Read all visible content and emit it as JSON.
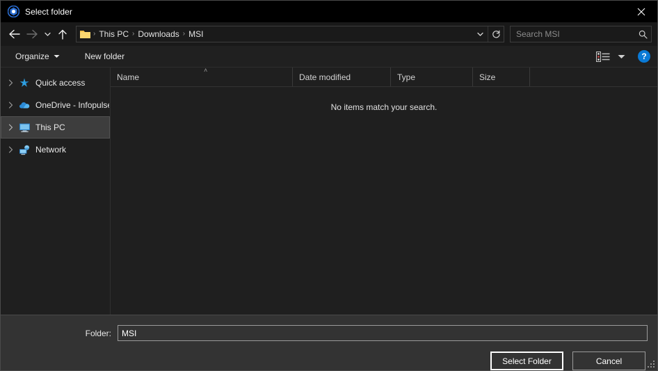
{
  "window": {
    "title": "Select folder",
    "app_icon": "app-logo-icon",
    "close_label": "✕",
    "accent_color": "#0a7ad6",
    "titlebar_bg": "#000000",
    "body_bg": "#1f1f1f",
    "footer_bg": "#333333"
  },
  "nav": {
    "back_label": "Back",
    "forward_label": "Forward",
    "recent_label": "Recent locations",
    "up_label": "Up one level"
  },
  "address": {
    "folder_icon": "folder-icon",
    "separator": "›",
    "crumbs": [
      {
        "label": "This PC"
      },
      {
        "label": "Downloads"
      },
      {
        "label": "MSI"
      }
    ],
    "dropdown_label": "Previous locations",
    "refresh_label": "Refresh"
  },
  "search": {
    "placeholder": "Search MSI",
    "value": "",
    "icon": "search-icon"
  },
  "toolbar": {
    "organize_label": "Organize",
    "new_folder_label": "New folder",
    "view_label": "Change your view",
    "view_chevron_label": "More options",
    "help_label": "?"
  },
  "sidebar": {
    "items": [
      {
        "label": "Quick access",
        "icon": "star-icon",
        "selected": false
      },
      {
        "label": "OneDrive - Infopulse",
        "icon": "cloud-icon",
        "selected": false
      },
      {
        "label": "This PC",
        "icon": "monitor-icon",
        "selected": true
      },
      {
        "label": "Network",
        "icon": "network-icon",
        "selected": false
      }
    ]
  },
  "filelist": {
    "columns": [
      {
        "label": "Name",
        "sorted": true,
        "sort_direction": "˄"
      },
      {
        "label": "Date modified",
        "sorted": false
      },
      {
        "label": "Type",
        "sorted": false
      },
      {
        "label": "Size",
        "sorted": false
      }
    ],
    "rows": [],
    "empty_message": "No items match your search."
  },
  "footer": {
    "folder_label": "Folder:",
    "folder_value": "MSI",
    "folder_placeholder": "",
    "select_button": "Select Folder",
    "cancel_button": "Cancel",
    "resize_grip": "resize-grip"
  }
}
